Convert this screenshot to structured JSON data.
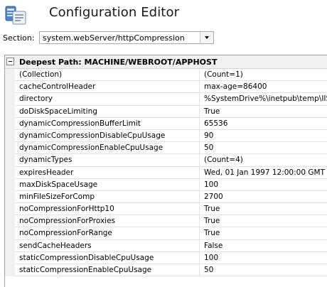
{
  "header": {
    "title": "Configuration Editor",
    "icon": "config-editor-icon"
  },
  "section": {
    "label": "Section:",
    "value": "system.webServer/httpCompression"
  },
  "grid": {
    "group_title": "Deepest Path: MACHINE/WEBROOT/APPHOST",
    "rows": [
      {
        "name": "(Collection)",
        "value": "(Count=1)"
      },
      {
        "name": "cacheControlHeader",
        "value": "max-age=86400"
      },
      {
        "name": "directory",
        "value": "%SystemDrive%\\inetpub\\temp\\IIS"
      },
      {
        "name": "doDiskSpaceLimiting",
        "value": "True"
      },
      {
        "name": "dynamicCompressionBufferLimit",
        "value": "65536"
      },
      {
        "name": "dynamicCompressionDisableCpuUsage",
        "value": "90"
      },
      {
        "name": "dynamicCompressionEnableCpuUsage",
        "value": "50"
      },
      {
        "name": "dynamicTypes",
        "value": "(Count=4)"
      },
      {
        "name": "expiresHeader",
        "value": "Wed, 01 Jan 1997 12:00:00 GMT"
      },
      {
        "name": "maxDiskSpaceUsage",
        "value": "100"
      },
      {
        "name": "minFileSizeForComp",
        "value": "2700"
      },
      {
        "name": "noCompressionForHttp10",
        "value": "True"
      },
      {
        "name": "noCompressionForProxies",
        "value": "True"
      },
      {
        "name": "noCompressionForRange",
        "value": "True"
      },
      {
        "name": "sendCacheHeaders",
        "value": "False"
      },
      {
        "name": "staticCompressionDisableCpuUsage",
        "value": "100"
      },
      {
        "name": "staticCompressionEnableCpuUsage",
        "value": "50"
      }
    ]
  }
}
